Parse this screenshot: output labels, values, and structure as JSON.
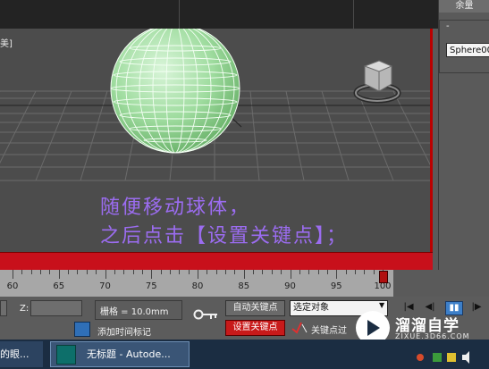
{
  "top_panel": {
    "label": "余量"
  },
  "viewport": {
    "label": "美]",
    "overlay_line1": "随便移动球体，",
    "overlay_line2": "之后点击【设置关键点】；"
  },
  "right_panel": {
    "collapse_symbol": "-",
    "object_name": "Sphere00"
  },
  "timeline": {
    "ticks": [
      "60",
      "65",
      "70",
      "75",
      "80",
      "85",
      "90",
      "95",
      "100"
    ],
    "current_frame": 100
  },
  "controls": {
    "z_label": "Z:",
    "grid": "栅格 = 10.0mm",
    "auto_key": "自动关键点",
    "set_key": "设置关键点",
    "selection_dropdown": "选定对象",
    "key_filters": "关键点过",
    "add_time_tag": "添加时间标记"
  },
  "taskbar": {
    "item1": "的眼...",
    "item2": "无标题 - Autode..."
  },
  "watermark": {
    "title": "溜溜自学",
    "subtitle": "ZIXUE.3D66.COM"
  },
  "colors": {
    "accent_red": "#c8101b",
    "overlay_text": "#9b6cf0",
    "sphere_fill": "#9fdc9f"
  }
}
